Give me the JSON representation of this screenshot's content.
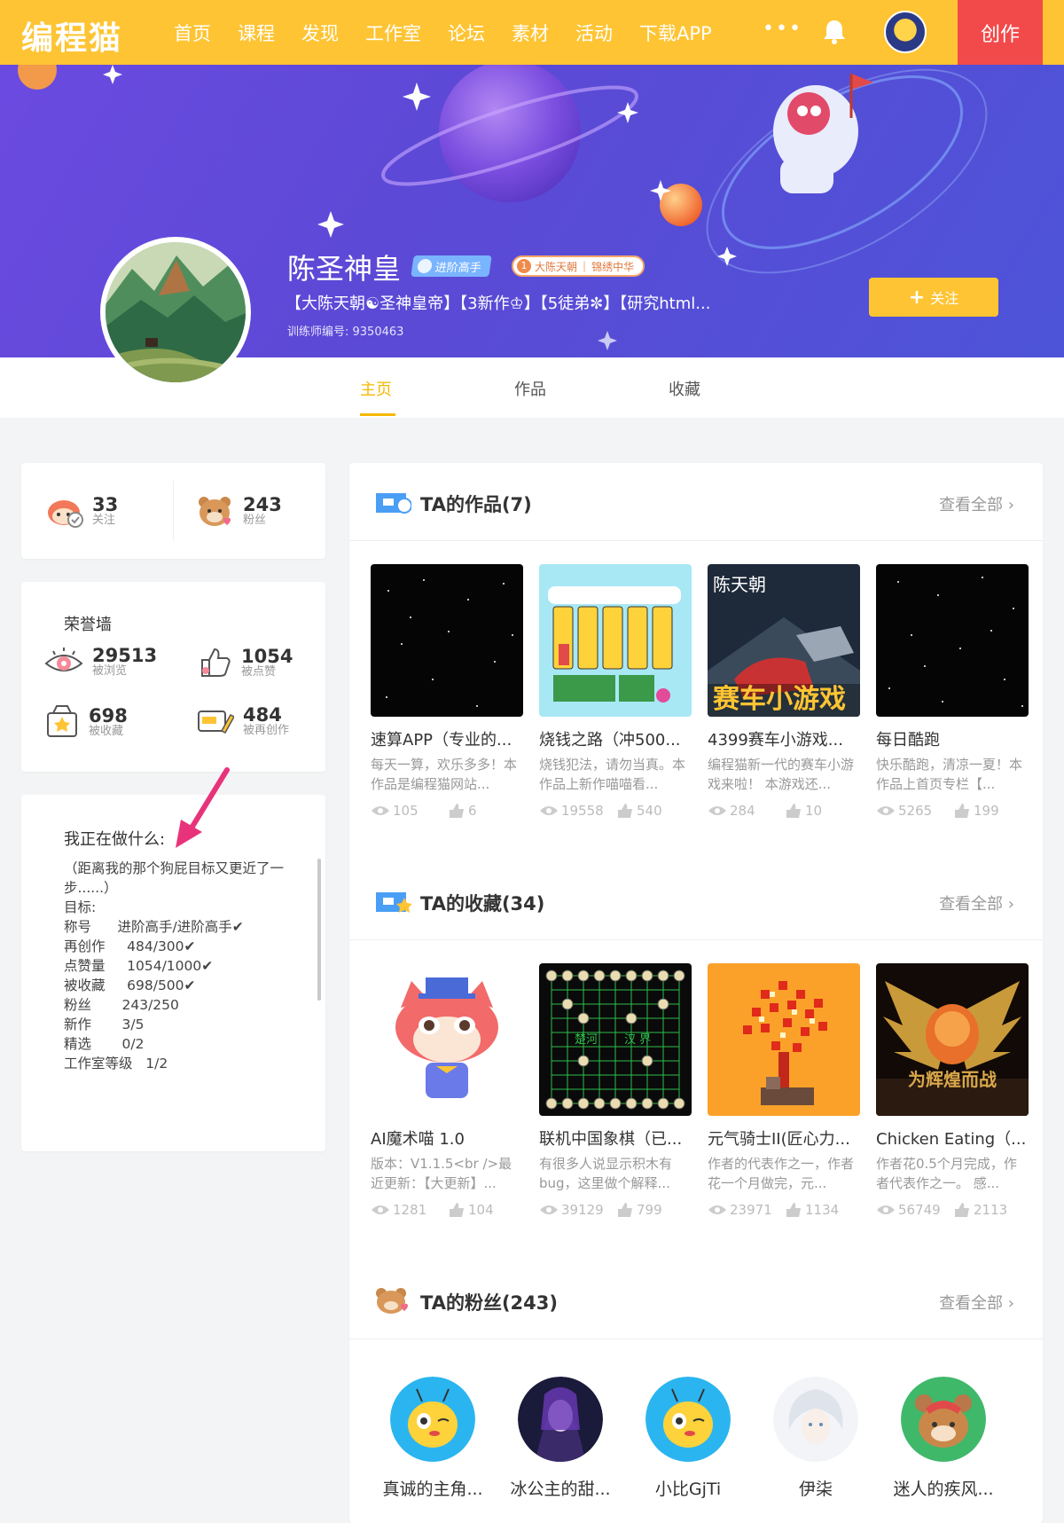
{
  "nav": {
    "logo": "编程猫",
    "items": [
      "首页",
      "课程",
      "发现",
      "工作室",
      "论坛",
      "素材",
      "活动",
      "下载APP"
    ],
    "more": "•••",
    "create": "创作"
  },
  "profile": {
    "name": "陈圣神皇",
    "level_badge": "进阶高手",
    "studio_badge": {
      "number": "1",
      "name": "大陈天朝",
      "motto": "锦绣中华"
    },
    "description": "【大陈天朝☯圣神皇帝】【3新作♔】【5徒弟✼】【研究html...",
    "trainer_id": "训练师编号: 9350463",
    "follow_label": "关注"
  },
  "tabs": [
    "主页",
    "作品",
    "收藏"
  ],
  "social": {
    "following": {
      "count": "33",
      "label": "关注"
    },
    "fans": {
      "count": "243",
      "label": "粉丝"
    }
  },
  "honor": {
    "title": "荣誉墙",
    "items": [
      {
        "count": "29513",
        "label": "被浏览",
        "icon": "eye-icon"
      },
      {
        "count": "1054",
        "label": "被点赞",
        "icon": "like-icon"
      },
      {
        "count": "698",
        "label": "被收藏",
        "icon": "collect-icon"
      },
      {
        "count": "484",
        "label": "被再创作",
        "icon": "remix-icon"
      }
    ]
  },
  "doing": {
    "title": "我正在做什么:",
    "lines": [
      "（距离我的那个狗屁目标又更近了一",
      "步......）",
      "目标:",
      "称号      进阶高手/进阶高手✔",
      "再创作     484/300✔",
      "点赞量     1054/1000✔",
      "被收藏     698/500✔",
      "粉丝       243/250",
      "新作       3/5",
      "精选       0/2",
      "工作室等级   1/2"
    ]
  },
  "works": {
    "title": "TA的作品(7)",
    "view_all": "查看全部",
    "items": [
      {
        "title": "速算APP（专业的...",
        "desc": "每天一算，欢乐多多！本作品是编程猫网站...",
        "views": "105",
        "likes": "6",
        "thumb": "starfield"
      },
      {
        "title": "烧钱之路（冲500...",
        "desc": "烧钱犯法，请勿当真。本作品上新作喵喵看...",
        "views": "19558",
        "likes": "540",
        "thumb": "shop"
      },
      {
        "title": "4399赛车小游戏...",
        "desc": "编程猫新一代的赛车小游戏来啦！ 本游戏还...",
        "views": "284",
        "likes": "10",
        "thumb": "racing"
      },
      {
        "title": "每日酷跑",
        "desc": "快乐酷跑，清凉一夏！本作品上首页专栏【...",
        "views": "5265",
        "likes": "199",
        "thumb": "starfield"
      }
    ]
  },
  "collections": {
    "title": "TA的收藏(34)",
    "view_all": "查看全部",
    "items": [
      {
        "title": "AI魔术喵 1.0",
        "desc": "版本：V1.1.5<br />最近更新：【大更新】...",
        "views": "1281",
        "likes": "104",
        "thumb": "cat"
      },
      {
        "title": "联机中国象棋（已...",
        "desc": "有很多人说显示积木有bug，这里做个解释...",
        "views": "39129",
        "likes": "799",
        "thumb": "chess"
      },
      {
        "title": "元气骑士II(匠心力...",
        "desc": "作者的代表作之一，作者花一个月做完，元...",
        "views": "23971",
        "likes": "1134",
        "thumb": "fire"
      },
      {
        "title": "Chicken Eating（...",
        "desc": "作者花0.5个月完成，作者代表作之一。 感...",
        "views": "56749",
        "likes": "2113",
        "thumb": "fist"
      }
    ]
  },
  "fans": {
    "title": "TA的粉丝(243)",
    "view_all": "查看全部",
    "items": [
      {
        "name": "真诚的主角...",
        "avatar": "bee"
      },
      {
        "name": "冰公主的甜...",
        "avatar": "dark"
      },
      {
        "name": "小比GjTi",
        "avatar": "bee"
      },
      {
        "name": "伊柒",
        "avatar": "white"
      },
      {
        "name": "迷人的疾风...",
        "avatar": "bear"
      }
    ]
  },
  "thumb_texts": {
    "racing_top": "陈天朝",
    "racing_bottom": "赛车小游戏",
    "chess_river": "汉 界",
    "chess_river2": "楚河",
    "fist_caption": "为辉煌而战"
  },
  "colors": {
    "brand_yellow": "#fec433",
    "create_red": "#f24a4a",
    "banner_purple": "#5c49d6",
    "active_tab": "#f5b800"
  }
}
